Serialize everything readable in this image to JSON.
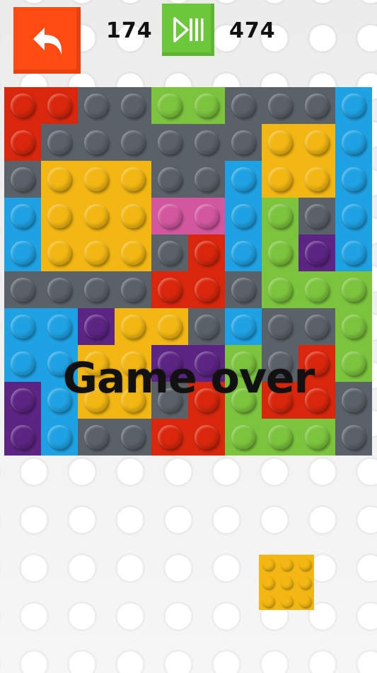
{
  "hud": {
    "current_score": "174",
    "best_score": "474"
  },
  "colors": {
    "R": "#d9270d",
    "G": "#5b6168",
    "L": "#7cc43d",
    "B": "#1fa2e3",
    "Y": "#f2b713",
    "P": "#d2579f",
    "V": "#5c2583",
    "undo": "#ff4a12",
    "play": "#6bc83a"
  },
  "board": {
    "rows": [
      [
        "R",
        "R",
        "G",
        "G",
        "L",
        "L",
        "G",
        "G",
        "G",
        "B"
      ],
      [
        "R",
        "G",
        "G",
        "G",
        "G",
        "G",
        "G",
        "Y",
        "Y",
        "B"
      ],
      [
        "G",
        "Y",
        "Y",
        "Y",
        "G",
        "G",
        "B",
        "Y",
        "Y",
        "B"
      ],
      [
        "B",
        "Y",
        "Y",
        "Y",
        "P",
        "P",
        "B",
        "L",
        "G",
        "B"
      ],
      [
        "B",
        "Y",
        "Y",
        "Y",
        "G",
        "R",
        "B",
        "L",
        "V",
        "B"
      ],
      [
        "G",
        "G",
        "G",
        "G",
        "R",
        "R",
        "G",
        "L",
        "L",
        "L"
      ],
      [
        "B",
        "B",
        "V",
        "Y",
        "Y",
        "G",
        "B",
        "G",
        "G",
        "L"
      ],
      [
        "B",
        "B",
        "Y",
        "Y",
        "V",
        "V",
        "L",
        "G",
        "R",
        "L"
      ],
      [
        "V",
        "B",
        "Y",
        "Y",
        "G",
        "R",
        "L",
        "R",
        "R",
        "G"
      ],
      [
        "V",
        "B",
        "G",
        "G",
        "R",
        "R",
        "L",
        "L",
        "L",
        "G"
      ]
    ]
  },
  "overlay": {
    "message": "Game over"
  },
  "next_piece": {
    "color": "Y",
    "studs": 9
  }
}
